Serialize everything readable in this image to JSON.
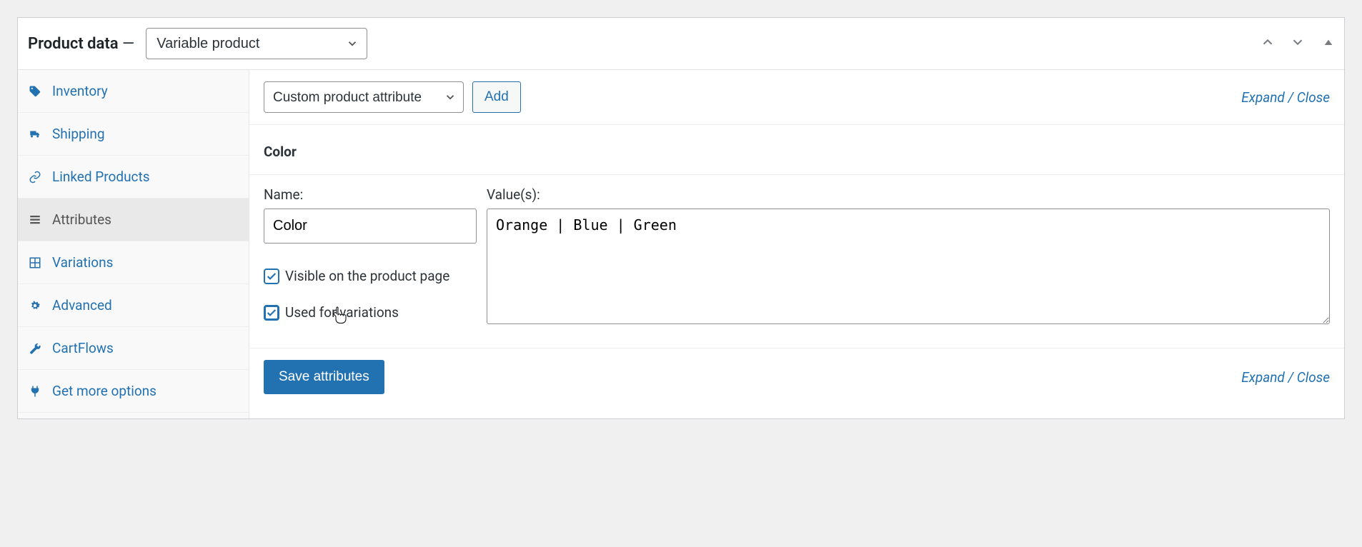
{
  "header": {
    "title": "Product data",
    "dash": " — ",
    "product_type": "Variable product"
  },
  "sidebar": {
    "tabs": [
      {
        "label": "Inventory",
        "icon": "tag-icon"
      },
      {
        "label": "Shipping",
        "icon": "truck-icon"
      },
      {
        "label": "Linked Products",
        "icon": "link-icon"
      },
      {
        "label": "Attributes",
        "icon": "list-icon"
      },
      {
        "label": "Variations",
        "icon": "grid-icon"
      },
      {
        "label": "Advanced",
        "icon": "gear-icon"
      },
      {
        "label": "CartFlows",
        "icon": "wrench-icon"
      },
      {
        "label": "Get more options",
        "icon": "plug-icon"
      }
    ],
    "active_index": 3
  },
  "toolbar": {
    "attribute_select": "Custom product attribute",
    "add_label": "Add",
    "expand_close": "Expand / Close"
  },
  "attribute": {
    "title": "Color",
    "name_label": "Name:",
    "name_value": "Color",
    "values_label": "Value(s):",
    "values_text": "Orange | Blue | Green",
    "visible_label": "Visible on the product page",
    "visible_checked": true,
    "used_label": "Used for variations",
    "used_checked": true
  },
  "footer": {
    "save_label": "Save attributes",
    "expand_close": "Expand / Close"
  }
}
